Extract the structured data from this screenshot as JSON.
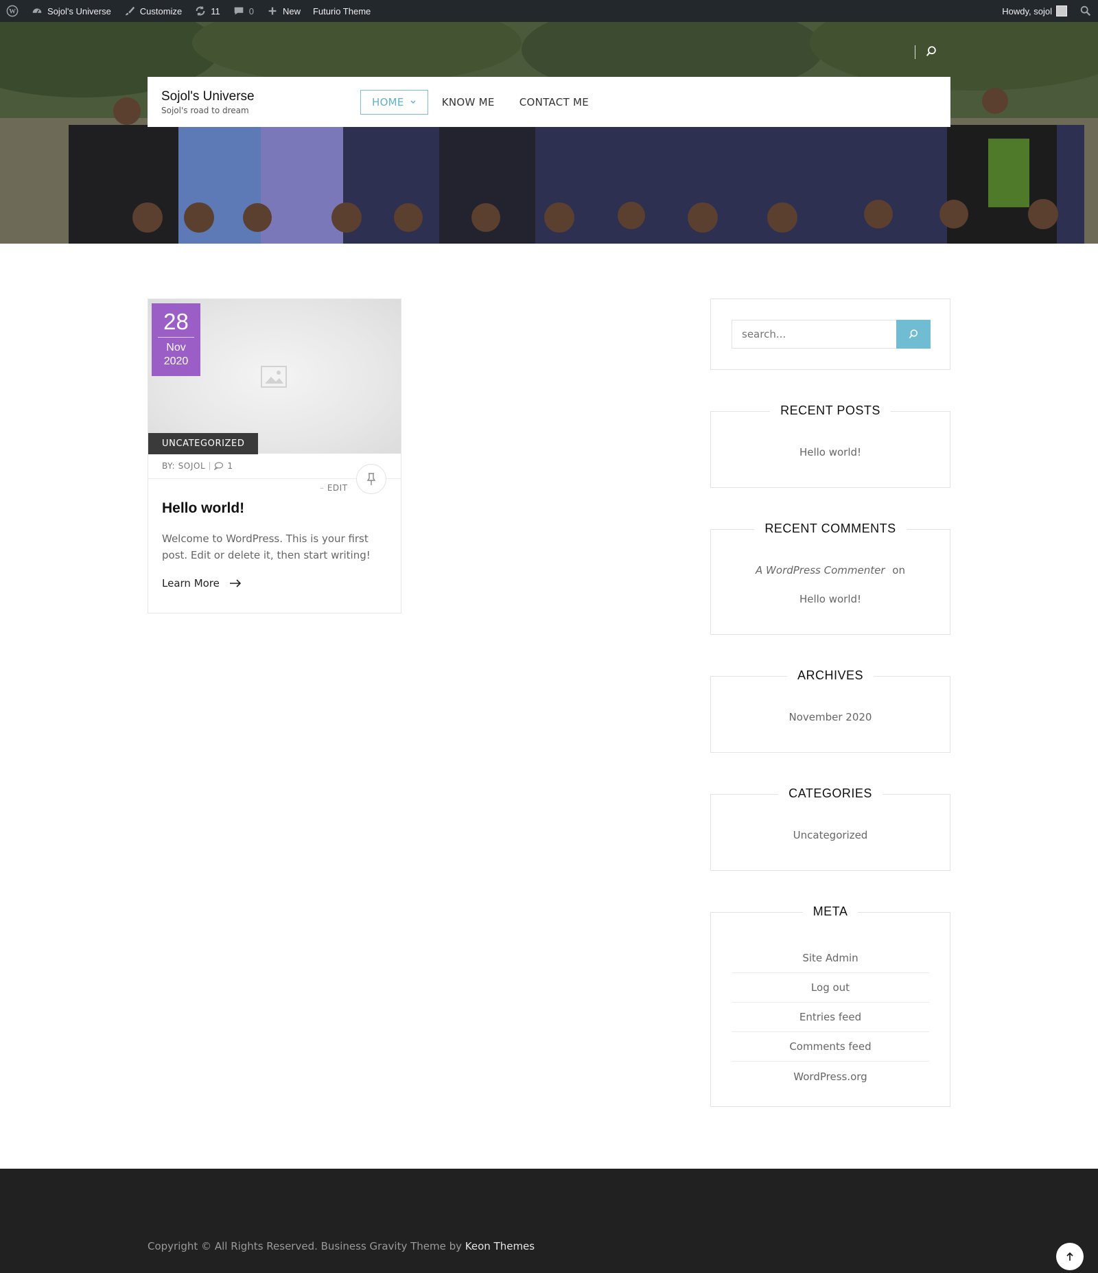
{
  "admin_bar": {
    "site_name": "Sojol's Universe",
    "customize": "Customize",
    "updates_count": "11",
    "comments_count": "0",
    "new_label": "New",
    "theme_label": "Futurio Theme",
    "howdy": "Howdy, sojol",
    "icons": [
      "wordpress-logo-icon",
      "dashboard-icon",
      "brush-icon",
      "updates-icon",
      "comment-icon",
      "plus-icon",
      "search-icon"
    ]
  },
  "header": {
    "site_title": "Sojol's Universe",
    "tagline": "Sojol's road to dream",
    "nav": [
      {
        "label": "HOME",
        "active": true
      },
      {
        "label": "KNOW ME"
      },
      {
        "label": "CONTACT ME"
      }
    ]
  },
  "post": {
    "day": "28",
    "month": "Nov",
    "year": "2020",
    "category": "UNCATEGORIZED",
    "author": "BY: SOJOL",
    "comment_count": "1",
    "edit_label": "EDIT",
    "title": "Hello world!",
    "excerpt": "Welcome to WordPress. This is your first post. Edit or delete it, then start writing!",
    "learn_more": "Learn More"
  },
  "sidebar": {
    "search_placeholder": "search...",
    "recent_posts": {
      "title": "RECENT POSTS",
      "items": [
        "Hello world!"
      ]
    },
    "recent_comments": {
      "title": "RECENT COMMENTS",
      "author": "A WordPress Commenter",
      "on": "on",
      "post": "Hello world!"
    },
    "archives": {
      "title": "ARCHIVES",
      "items": [
        "November 2020"
      ]
    },
    "categories": {
      "title": "CATEGORIES",
      "items": [
        "Uncategorized"
      ]
    },
    "meta": {
      "title": "META",
      "items": [
        "Site Admin",
        "Log out",
        "Entries feed",
        "Comments feed",
        "WordPress.org"
      ]
    }
  },
  "footer": {
    "copyright": "Copyright © All Rights Reserved. Business Gravity Theme by",
    "theme_author": "Keon Themes"
  },
  "colors": {
    "admin_bar": "#23282d",
    "accent": "#70bcd2",
    "date_badge": "#9b5ec6",
    "footer": "#212121"
  }
}
